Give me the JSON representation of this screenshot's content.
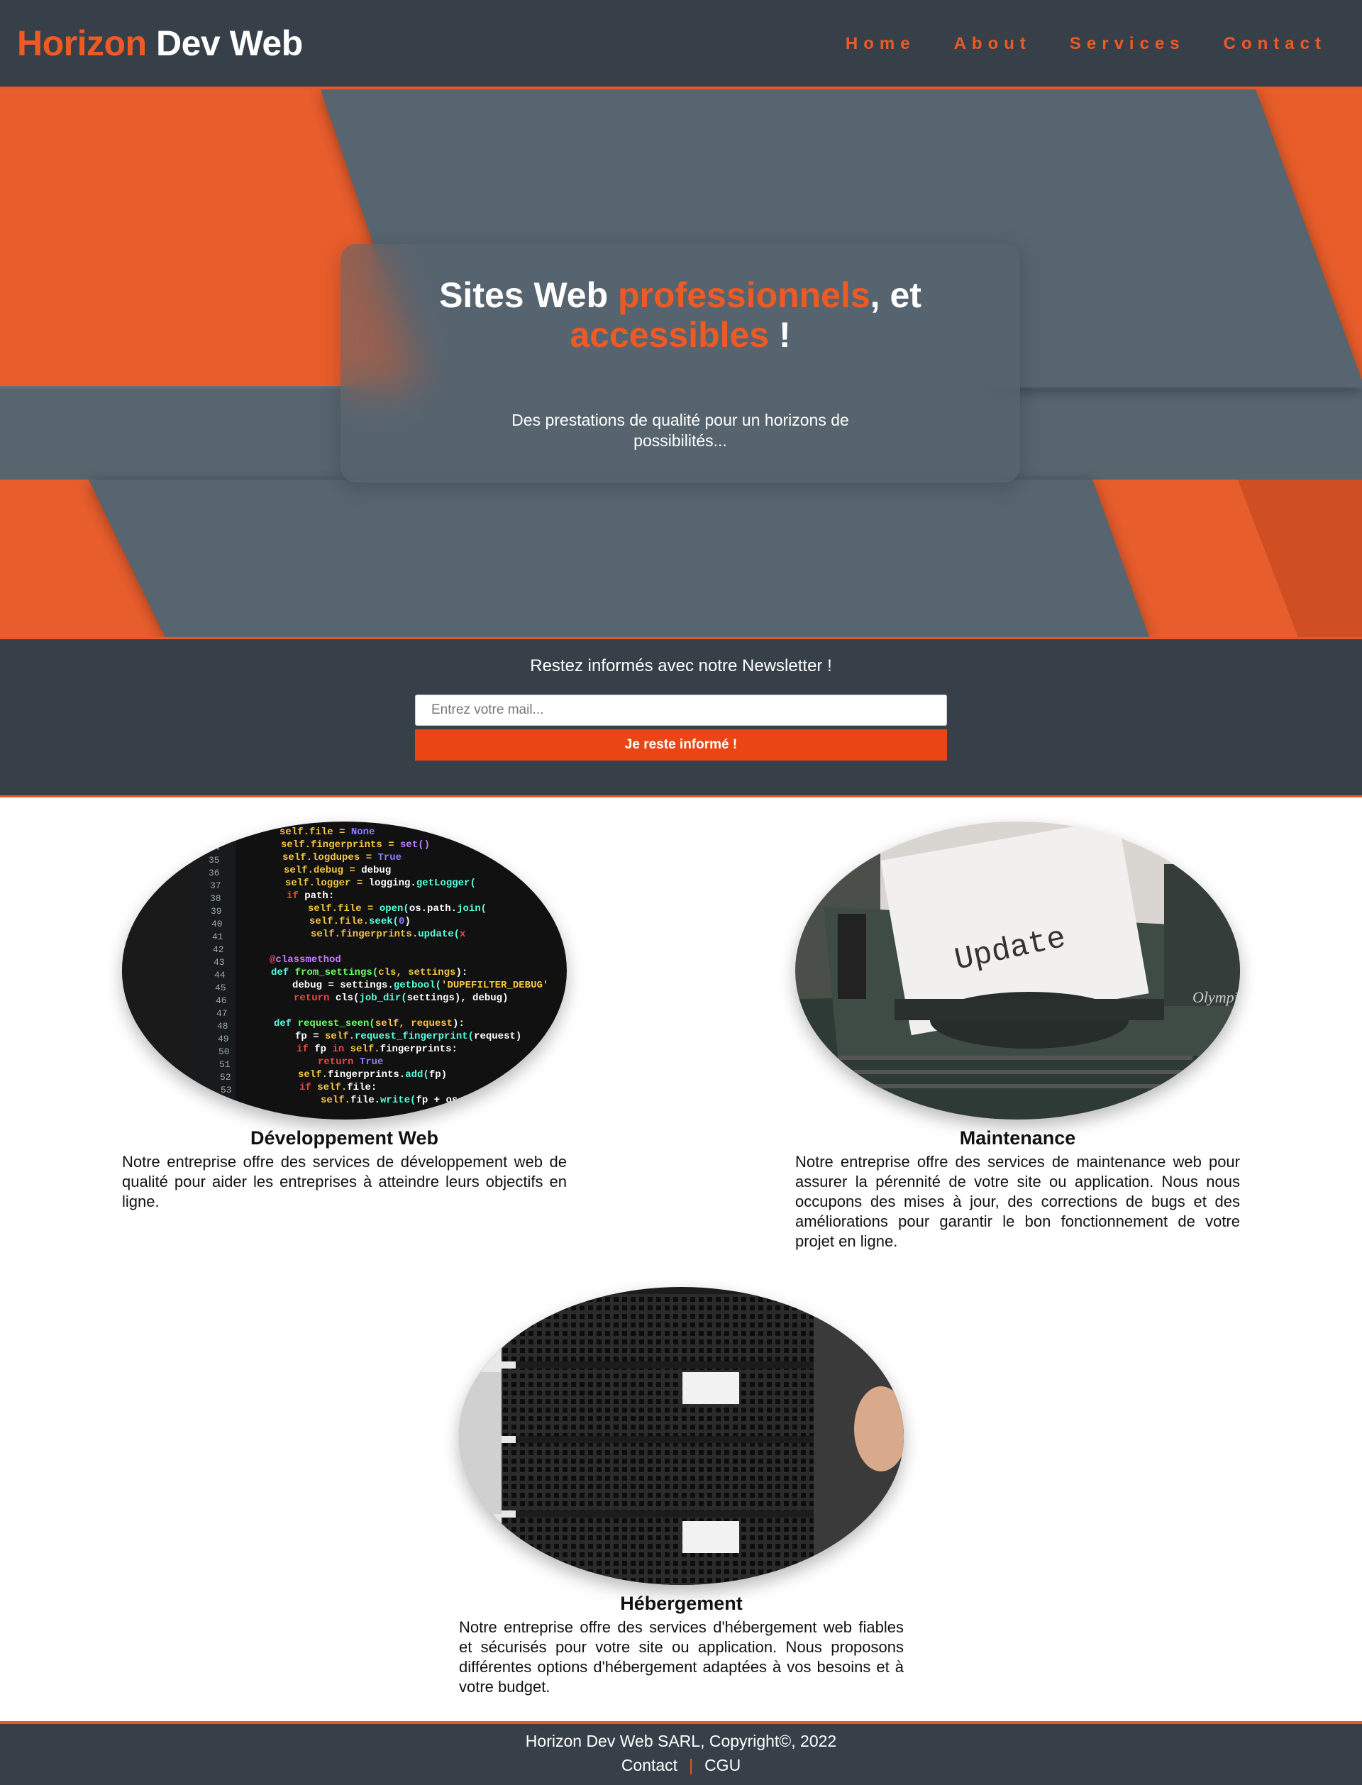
{
  "header": {
    "brand_part1": "Horizon",
    "brand_part2": "Dev Web",
    "nav": [
      "Home",
      "About",
      "Services",
      "Contact"
    ]
  },
  "hero": {
    "title_part1": "Sites Web ",
    "title_accent1": "professionnels",
    "title_part2": ", et ",
    "title_accent2": "accessibles",
    "title_part3": " !",
    "subtitle": "Des prestations de qualité pour un horizons de possibilités..."
  },
  "newsletter": {
    "title": "Restez informés avec notre Newsletter !",
    "input_placeholder": "Entrez votre mail...",
    "button_label": "Je reste informé !"
  },
  "services": [
    {
      "title": "Développement Web",
      "description": "Notre entreprise offre des services de développement web de qualité pour aider les entreprises à atteindre leurs objectifs en ligne.",
      "image": "code-editor-photo"
    },
    {
      "title": "Maintenance",
      "description": "Notre entreprise offre des services de maintenance web pour assurer la pérennité de votre site ou application. Nous nous occupons des mises à jour, des corrections de bugs et des améliorations pour garantir le bon fonctionnement de votre projet en ligne.",
      "image": "typewriter-update-photo",
      "typewriter_word": "Update"
    },
    {
      "title": "Hébergement",
      "description": "Notre entreprise offre des services d'hébergement web fiables et sécurisés pour votre site ou application. Nous proposons différentes options d'hébergement adaptées à vos besoins et à votre budget.",
      "image": "server-rack-photo"
    }
  ],
  "footer": {
    "copyright": "Horizon Dev Web SARL, Copyright©, 2022",
    "links": [
      "Contact",
      "CGU"
    ],
    "separator": "|"
  },
  "colors": {
    "accent": "#ee5a24",
    "dark": "#374049",
    "hero_gray": "#57656f",
    "button": "#ea4514"
  }
}
